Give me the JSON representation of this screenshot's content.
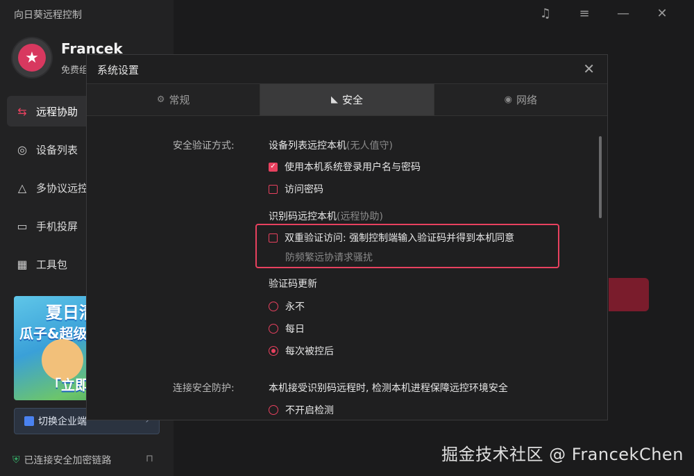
{
  "app": {
    "title": "向日葵远程控制",
    "username": "Francek",
    "user_plan": "免费组"
  },
  "sidebar": {
    "items": [
      {
        "label": "远程协助",
        "icon": "remote-assist-icon",
        "active": true
      },
      {
        "label": "设备列表",
        "icon": "device-list-icon",
        "active": false
      },
      {
        "label": "多协议远控",
        "icon": "multi-protocol-icon",
        "active": false
      },
      {
        "label": "手机投屏",
        "icon": "screen-cast-icon",
        "active": false
      },
      {
        "label": "工具包",
        "icon": "toolbox-icon",
        "active": false
      }
    ],
    "promo": {
      "line1": "夏日清",
      "line2": "瓜子&超级",
      "line3": "「立即"
    },
    "switch_label": "切换企业端",
    "secure_status": "已连接安全加密链路"
  },
  "dialog": {
    "title": "系统设置",
    "tabs": [
      {
        "label": "常规",
        "icon": "gear-icon",
        "active": false
      },
      {
        "label": "安全",
        "icon": "shield-icon",
        "active": true
      },
      {
        "label": "网络",
        "icon": "globe-icon",
        "active": false
      }
    ],
    "security": {
      "label": "安全验证方式:",
      "device_group": {
        "title": "设备列表远控本机",
        "hint": "(无人值守)"
      },
      "opt_os_login": {
        "label": "使用本机系统登录用户名与密码",
        "checked": true
      },
      "opt_access_pwd": {
        "label": "访问密码",
        "checked": false
      },
      "code_group": {
        "title": "识别码远控本机",
        "hint": "(远程协助)"
      },
      "opt_two_factor": {
        "label": "双重验证访问: 强制控制端输入验证码并得到本机同意",
        "checked": false,
        "subtext": "防频繁远协请求骚扰"
      },
      "refresh_group": {
        "title": "验证码更新"
      },
      "refresh_options": [
        {
          "label": "永不",
          "checked": false
        },
        {
          "label": "每日",
          "checked": false
        },
        {
          "label": "每次被控后",
          "checked": true
        }
      ]
    },
    "connection": {
      "label": "连接安全防护:",
      "desc": "本机接受识别码远程时, 检测本机进程保障远控环境安全",
      "opt_no_check": {
        "label": "不开启检测",
        "checked": false
      }
    }
  },
  "watermark": "掘金技术社区 @ FrancekChen",
  "colors": {
    "accent": "#e8415f",
    "background": "#1b1b1c",
    "sidebar": "#222223",
    "dialog": "#1f1f20"
  }
}
